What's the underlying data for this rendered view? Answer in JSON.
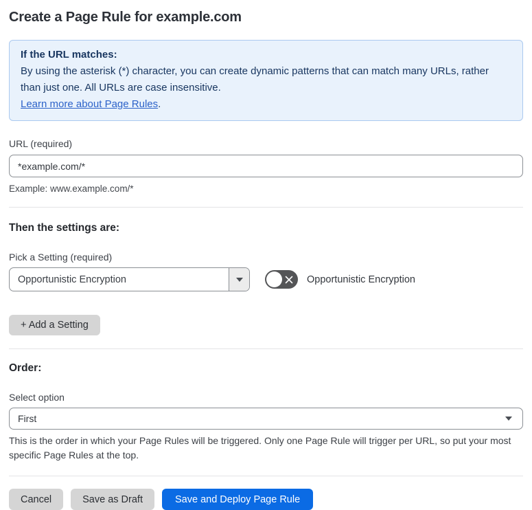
{
  "page": {
    "title": "Create a Page Rule for example.com"
  },
  "info_box": {
    "heading": "If the URL matches:",
    "body": "By using the asterisk (*) character, you can create dynamic patterns that can match many URLs, rather than just one. All URLs are case insensitive.",
    "link_text": "Learn more about Page Rules",
    "link_suffix": "."
  },
  "url_field": {
    "label": "URL (required)",
    "value": "*example.com/*",
    "helper": "Example: www.example.com/*"
  },
  "settings_section": {
    "heading": "Then the settings are:",
    "picker_label": "Pick a Setting (required)",
    "selected_setting": "Opportunistic Encryption",
    "toggle_state": "off",
    "toggle_label": "Opportunistic Encryption",
    "add_button_label": "+ Add a Setting"
  },
  "order_section": {
    "heading": "Order:",
    "label": "Select option",
    "selected_option": "First",
    "helper": "This is the order in which your Page Rules will be triggered. Only one Page Rule will trigger per URL, so put your most specific Page Rules at the top."
  },
  "actions": {
    "cancel_label": "Cancel",
    "save_draft_label": "Save as Draft",
    "save_deploy_label": "Save and Deploy Page Rule"
  },
  "colors": {
    "primary_blue": "#0b6be4",
    "info_background": "#e9f2fc",
    "info_border": "#abc9ef",
    "info_text": "#17355f",
    "link_blue": "#2c62c9",
    "toggle_off_gray": "#545557"
  }
}
